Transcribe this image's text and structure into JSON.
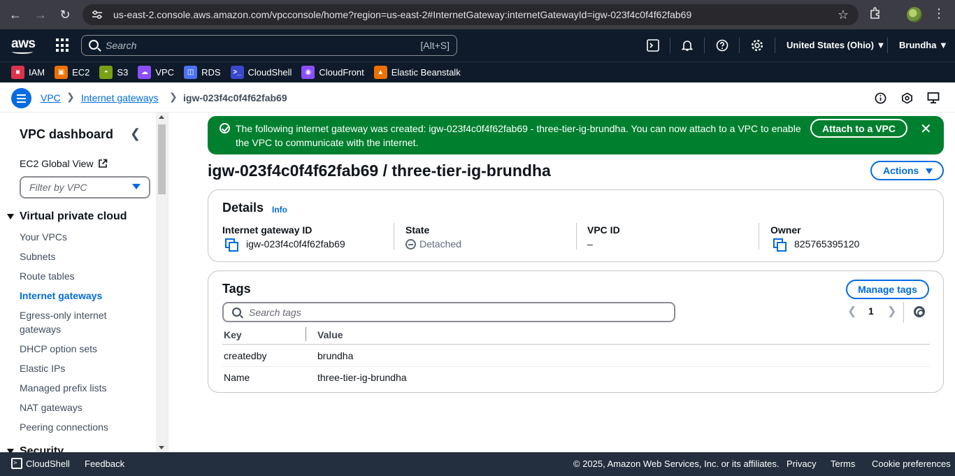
{
  "browser": {
    "url": "us-east-2.console.aws.amazon.com/vpcconsole/home?region=us-east-2#InternetGateway:internetGatewayId=igw-023f4c0f4f62fab69"
  },
  "awsnav": {
    "logo": "aws",
    "search_placeholder": "Search",
    "search_shortcut": "[Alt+S]",
    "region": "United States (Ohio) ▼",
    "user": "Brundha ▼"
  },
  "favorites": [
    {
      "label": "IAM",
      "color": "#dd344c"
    },
    {
      "label": "EC2",
      "color": "#ed7100"
    },
    {
      "label": "S3",
      "color": "#7aa116"
    },
    {
      "label": "VPC",
      "color": "#8c4fff"
    },
    {
      "label": "RDS",
      "color": "#4d72f3"
    },
    {
      "label": "CloudShell",
      "color": "#3b48cc"
    },
    {
      "label": "CloudFront",
      "color": "#8c4fff"
    },
    {
      "label": "Elastic Beanstalk",
      "color": "#ed7100"
    }
  ],
  "breadcrumb": {
    "root": "VPC",
    "parent": "Internet gateways",
    "current": "igw-023f4c0f4f62fab69"
  },
  "sidebar": {
    "title": "VPC dashboard",
    "global_view": "EC2 Global View",
    "filter_placeholder": "Filter by VPC",
    "section": "Virtual private cloud",
    "items": [
      "Your VPCs",
      "Subnets",
      "Route tables",
      "Internet gateways",
      "Egress-only internet gateways",
      "DHCP option sets",
      "Elastic IPs",
      "Managed prefix lists",
      "NAT gateways",
      "Peering connections"
    ],
    "next_section": "Security"
  },
  "flash": {
    "message": "The following internet gateway was created: igw-023f4c0f4f62fab69 - three-tier-ig-brundha. You can now attach to a VPC to enable the VPC to communicate with the internet.",
    "action": "Attach to a VPC"
  },
  "page": {
    "title": "igw-023f4c0f4f62fab69 / three-tier-ig-brundha",
    "actions": "Actions"
  },
  "details": {
    "title": "Details",
    "info": "Info",
    "fields": {
      "igw_label": "Internet gateway ID",
      "igw_value": "igw-023f4c0f4f62fab69",
      "state_label": "State",
      "state_value": "Detached",
      "vpc_label": "VPC ID",
      "vpc_value": "–",
      "owner_label": "Owner",
      "owner_value": "825765395120"
    }
  },
  "tags": {
    "title": "Tags",
    "manage": "Manage tags",
    "search_placeholder": "Search tags",
    "page": "1",
    "columns": [
      "Key",
      "Value"
    ],
    "rows": [
      {
        "key": "createdby",
        "value": "brundha"
      },
      {
        "key": "Name",
        "value": "three-tier-ig-brundha"
      }
    ]
  },
  "footer": {
    "cloudshell": "CloudShell",
    "feedback": "Feedback",
    "copyright": "© 2025, Amazon Web Services, Inc. or its affiliates.",
    "privacy": "Privacy",
    "terms": "Terms",
    "cookies": "Cookie preferences"
  }
}
